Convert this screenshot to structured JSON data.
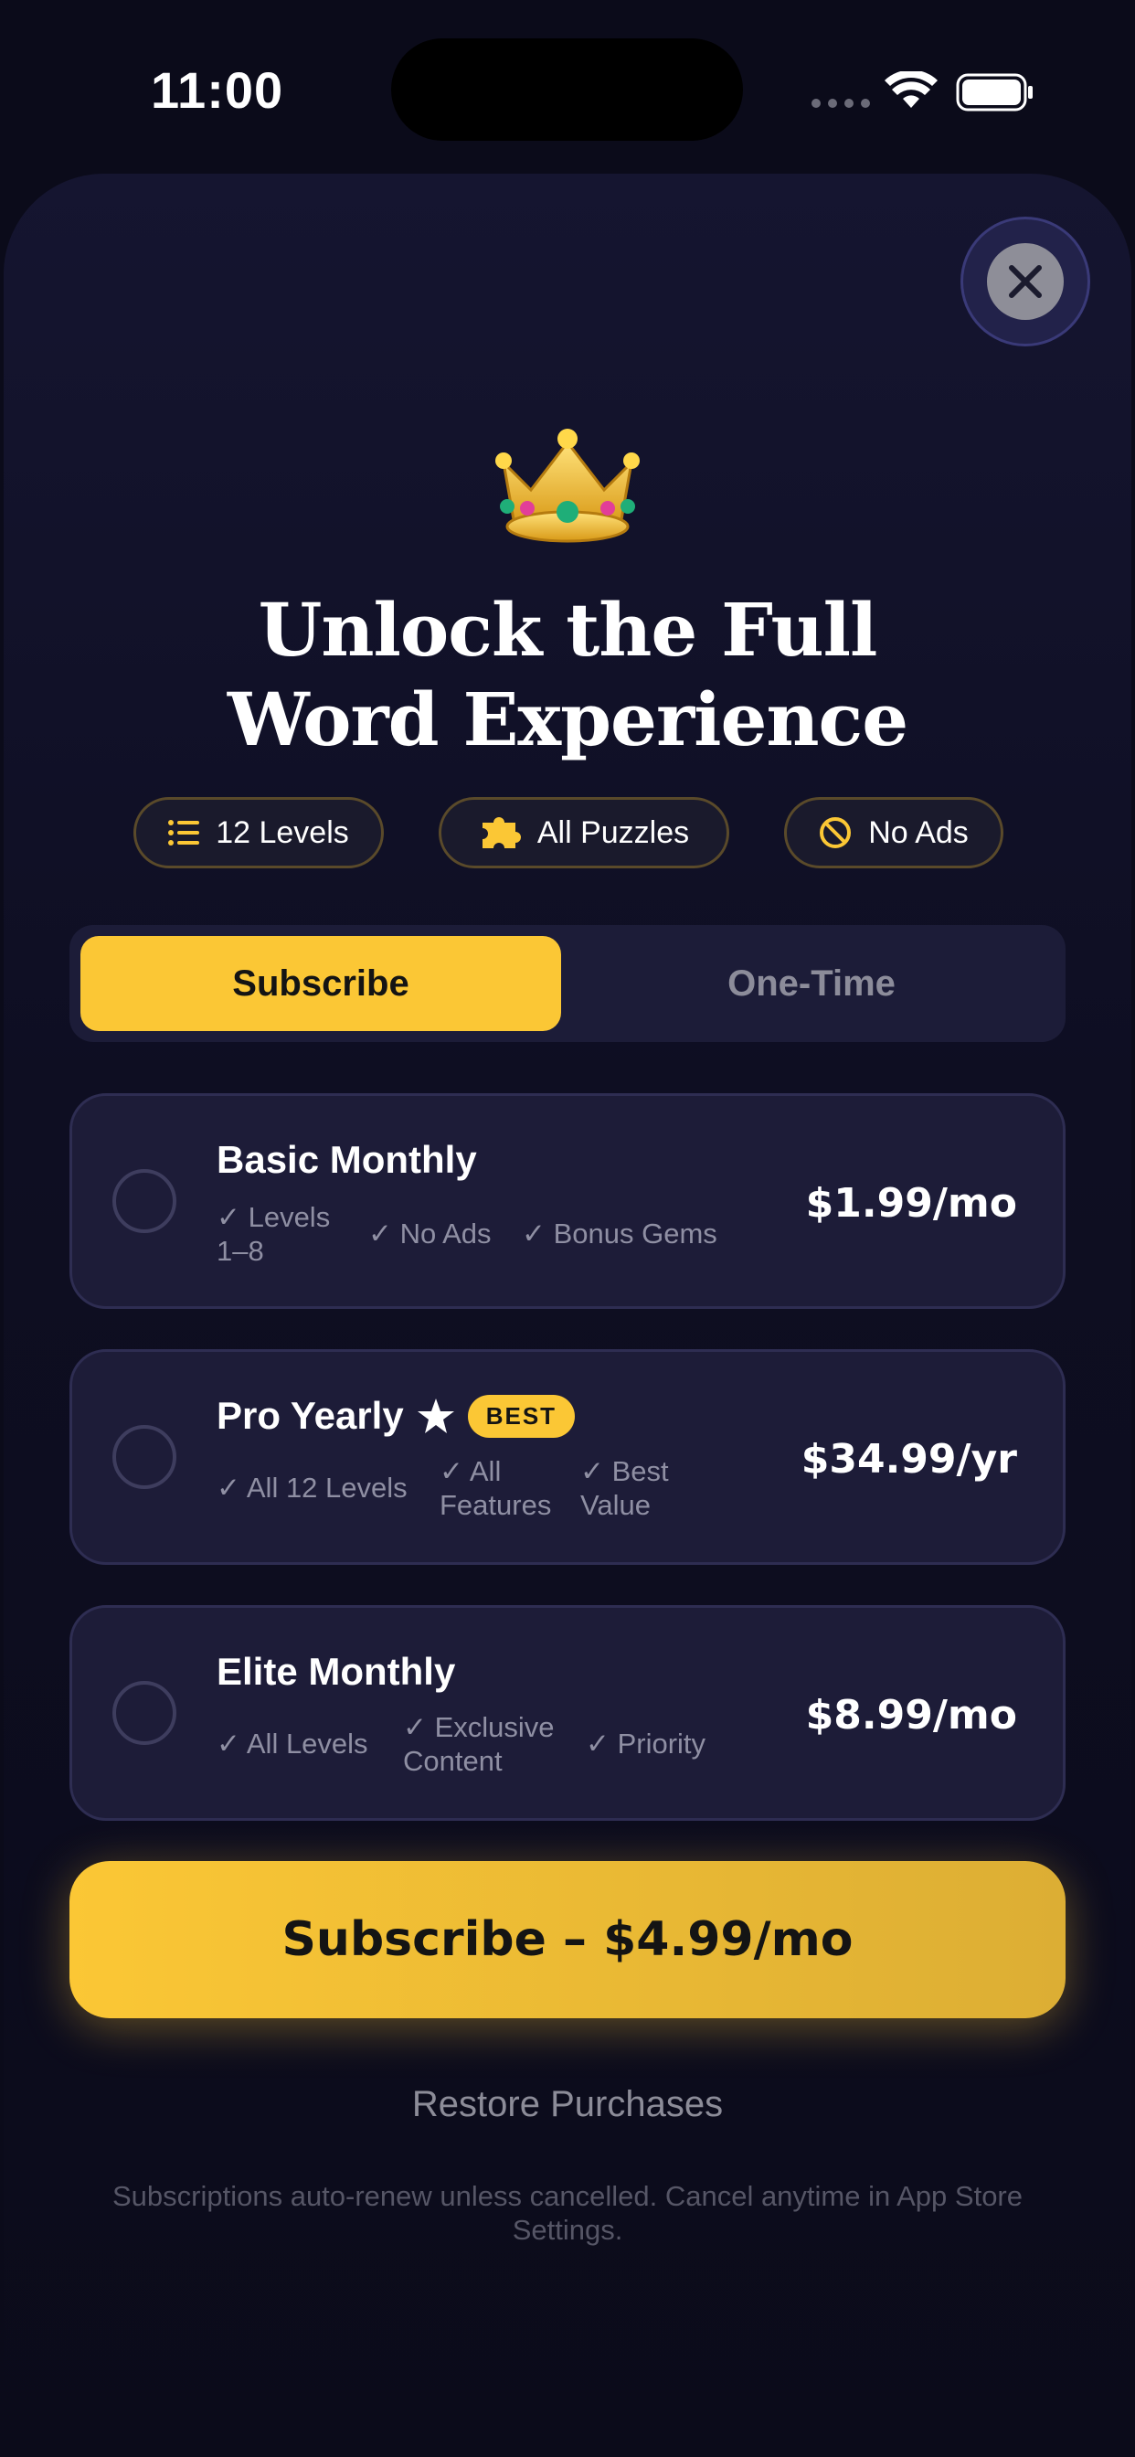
{
  "status_bar": {
    "time": "11:00"
  },
  "title_lines": [
    "Unlock the Full",
    "Word Experience"
  ],
  "chips": [
    {
      "label": "12 Levels",
      "icon": "list-icon"
    },
    {
      "label": "All Puzzles",
      "icon": "puzzle-icon"
    },
    {
      "label": "No Ads",
      "icon": "no-ads-icon"
    }
  ],
  "tabs": [
    {
      "label": "Subscribe",
      "active": true
    },
    {
      "label": "One-Time",
      "active": false
    }
  ],
  "plans": [
    {
      "name": "Basic Monthly",
      "price": "$1.99/mo",
      "features": [
        "✓ Levels 1–8",
        "✓ No Ads",
        "✓ Bonus Gems"
      ]
    },
    {
      "name": "Pro Yearly",
      "badge": "BEST",
      "price": "$34.99/yr",
      "features": [
        "✓ All 12 Levels",
        "✓ All Features",
        "✓ Best Value"
      ]
    },
    {
      "name": "Elite Monthly",
      "price": "$8.99/mo",
      "features": [
        "✓ All Levels",
        "✓ Exclusive Content",
        "✓ Priority"
      ]
    }
  ],
  "cta_label": "Subscribe – $4.99/mo",
  "restore_label": "Restore Purchases",
  "legal_text": "Subscriptions auto-renew unless cancelled. Cancel anytime in App Store Settings.",
  "colors": {
    "accent": "#fbc735",
    "background": "#0b0b1a",
    "card": "#1d1c38",
    "muted_text": "#8f8fa3"
  }
}
